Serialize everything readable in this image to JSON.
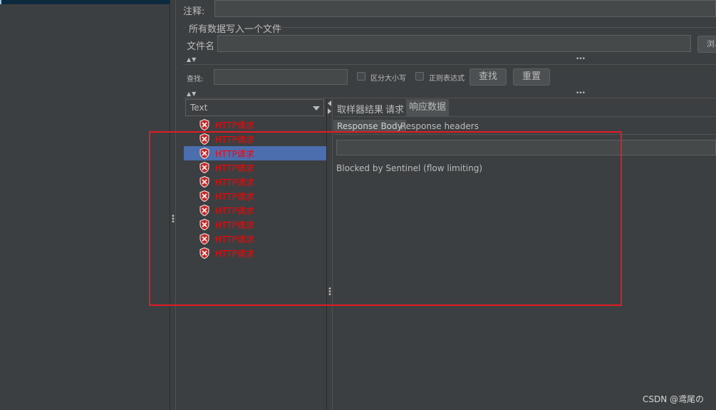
{
  "config": {
    "comment_label": "注释:",
    "file_section_title": "所有数据写入一个文件",
    "filename_label": "文件名",
    "browse_button_label": "浏..."
  },
  "search": {
    "label": "查找:",
    "case_sensitive_label": "区分大小写",
    "regex_label": "正则表达式",
    "find_button": "查找",
    "reset_button": "重置"
  },
  "renderer": {
    "selected": "Text"
  },
  "results": {
    "items": [
      {
        "label": "HTTP请求",
        "status_icon": "error-shield-icon"
      },
      {
        "label": "HTTP请求",
        "status_icon": "error-shield-icon"
      },
      {
        "label": "HTTP请求",
        "status_icon": "error-shield-icon",
        "selected": true
      },
      {
        "label": "HTTP请求",
        "status_icon": "error-shield-icon"
      },
      {
        "label": "HTTP请求",
        "status_icon": "error-shield-icon"
      },
      {
        "label": "HTTP请求",
        "status_icon": "error-shield-icon"
      },
      {
        "label": "HTTP请求",
        "status_icon": "error-shield-icon"
      },
      {
        "label": "HTTP请求",
        "status_icon": "error-shield-icon"
      },
      {
        "label": "HTTP请求",
        "status_icon": "error-shield-icon"
      },
      {
        "label": "HTTP请求",
        "status_icon": "error-shield-icon"
      }
    ],
    "error_color": "#ff0000",
    "selection_color": "#4b6eaf"
  },
  "detail": {
    "tabs": [
      "取样器结果",
      "请求",
      "响应数据"
    ],
    "active_tab": "响应数据",
    "subtabs": [
      "Response Body",
      "Response headers"
    ],
    "active_subtab": "Response Body",
    "response_body": "Blocked by Sentinel (flow limiting)"
  },
  "annotation": {
    "highlight_color": "#e31b23"
  },
  "watermark": "CSDN @鸢尾の"
}
